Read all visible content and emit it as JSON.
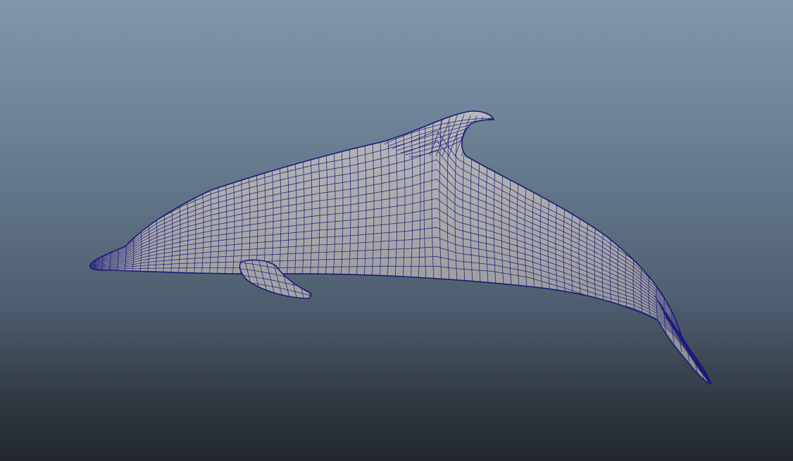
{
  "viewport": {
    "mode": "wireframe-on-shaded",
    "background_top": "#8196ad",
    "background_bottom": "#22272d"
  },
  "model": {
    "subject": "dolphin",
    "surface_color": "#a3a3a5",
    "wire_color": "#1a1a78"
  }
}
